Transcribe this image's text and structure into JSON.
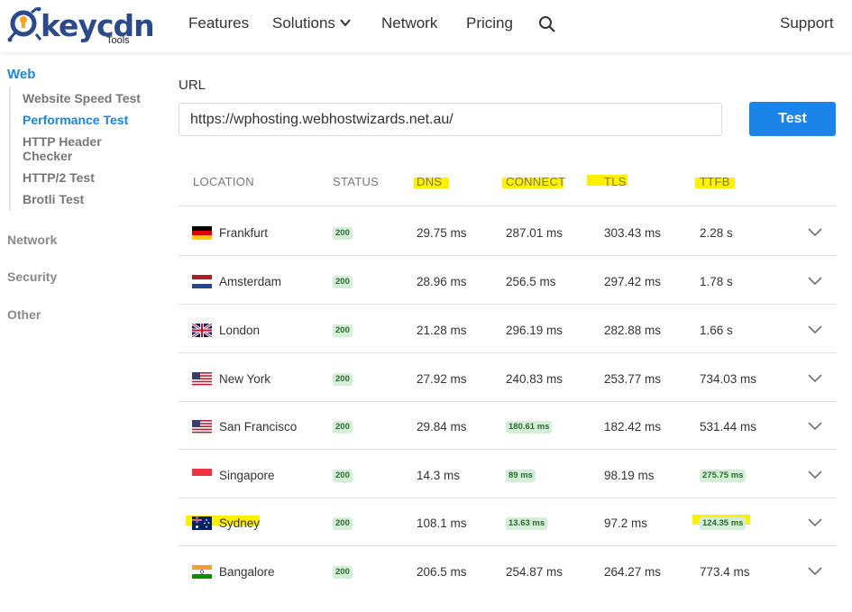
{
  "brand": {
    "name": "keycdn",
    "sub": "Tools"
  },
  "nav": {
    "features": "Features",
    "solutions": "Solutions",
    "network": "Network",
    "pricing": "Pricing",
    "support": "Support"
  },
  "sidebar": {
    "web": "Web",
    "items": [
      "Website Speed Test",
      "Performance Test",
      "HTTP Header Checker",
      "HTTP/2 Test",
      "Brotli Test"
    ],
    "groups": [
      "Network",
      "Security",
      "Other"
    ]
  },
  "form": {
    "label": "URL",
    "value": "https://wphosting.webhostwizards.net.au/",
    "button": "Test"
  },
  "table": {
    "headers": [
      "LOCATION",
      "STATUS",
      "DNS",
      "CONNECT",
      "TLS",
      "TTFB"
    ],
    "rows": [
      {
        "location": "Frankfurt",
        "flag": "de",
        "status": "200",
        "dns": "29.75 ms",
        "connect": "287.01 ms",
        "tls": "303.43 ms",
        "ttfb": "2.28 s"
      },
      {
        "location": "Amsterdam",
        "flag": "nl",
        "status": "200",
        "dns": "28.96 ms",
        "connect": "256.5 ms",
        "tls": "297.42 ms",
        "ttfb": "1.78 s"
      },
      {
        "location": "London",
        "flag": "gb",
        "status": "200",
        "dns": "21.28 ms",
        "connect": "296.19 ms",
        "tls": "282.88 ms",
        "ttfb": "1.66 s"
      },
      {
        "location": "New York",
        "flag": "us",
        "status": "200",
        "dns": "27.92 ms",
        "connect": "240.83 ms",
        "tls": "253.77 ms",
        "ttfb": "734.03 ms"
      },
      {
        "location": "San Francisco",
        "flag": "us",
        "status": "200",
        "dns": "29.84 ms",
        "connect": "180.61 ms",
        "tls": "182.42 ms",
        "ttfb": "531.44 ms"
      },
      {
        "location": "Singapore",
        "flag": "sg",
        "status": "200",
        "dns": "14.3 ms",
        "connect": "89 ms",
        "tls": "98.19 ms",
        "ttfb": "275.75 ms"
      },
      {
        "location": "Sydney",
        "flag": "au",
        "status": "200",
        "dns": "108.1 ms",
        "connect": "13.63 ms",
        "tls": "97.2 ms",
        "ttfb": "124.35 ms"
      },
      {
        "location": "Bangalore",
        "flag": "in",
        "status": "200",
        "dns": "206.5 ms",
        "connect": "254.87 ms",
        "tls": "264.27 ms",
        "ttfb": "773.4 ms"
      }
    ]
  },
  "colors": {
    "accent": "#1a84e8",
    "highlight": "#fff000",
    "badge_bg": "#d4efd7",
    "badge_text": "#2c6a30"
  }
}
